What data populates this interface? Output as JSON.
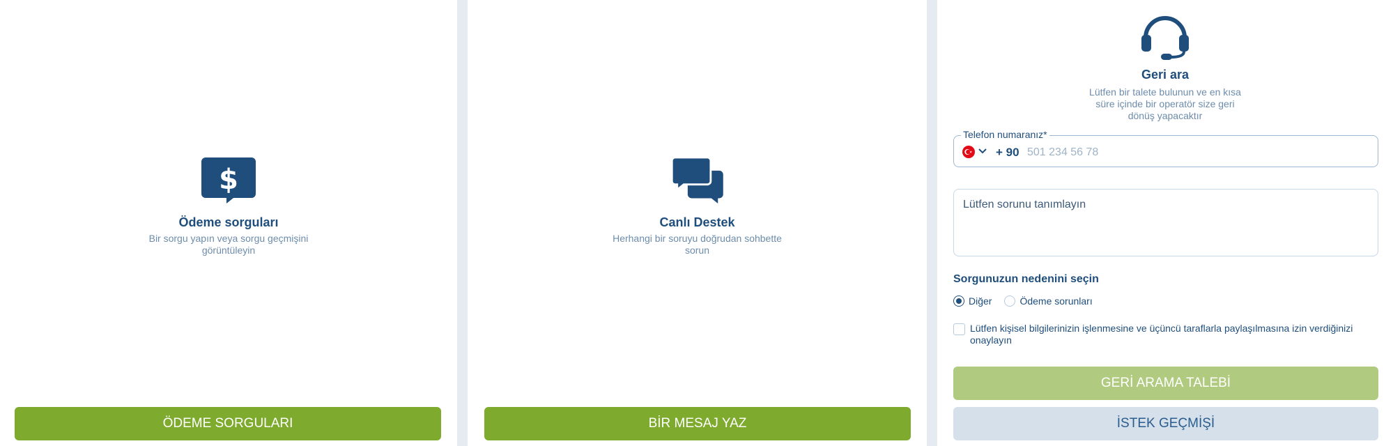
{
  "payment": {
    "icon": "dollar-speech-bubble-icon",
    "title": "Ödeme sorguları",
    "description": "Bir sorgu yapın veya sorgu geçmişini görüntüleyin",
    "button": "ÖDEME SORGULARI"
  },
  "live_support": {
    "icon": "chat-bubbles-icon",
    "title": "Canlı Destek",
    "description": "Herhangi bir soruyu doğrudan sohbette sorun",
    "button": "BİR MESAJ YAZ"
  },
  "callback": {
    "icon": "headset-icon",
    "title": "Geri ara",
    "description": "Lütfen bir talete bulunun ve en kısa süre içinde bir operatör size geri dönüş yapacaktır",
    "phone": {
      "label": "Telefon numaranız*",
      "flag_icon": "turkey-flag-icon",
      "dial_code": "+ 90",
      "placeholder": "501 234 56 78",
      "value": ""
    },
    "problem_placeholder": "Lütfen sorunu tanımlayın",
    "reason_label": "Sorgunuzun nedenini seçin",
    "reasons": [
      {
        "label": "Diğer",
        "checked": true
      },
      {
        "label": "Ödeme sorunları",
        "checked": false
      }
    ],
    "consent": "Lütfen kişisel bilgilerinizin işlenmesine ve üçüncü taraflarla paylaşılmasına izin verdiğinizi onaylayın",
    "consent_checked": false,
    "request_button": "GERİ ARAMA TALEBİ",
    "history_button": "İSTEK GEÇMİŞİ"
  },
  "colors": {
    "primary_dark": "#1f4e7c",
    "muted_text": "#6d8cab",
    "green": "#7eab2e",
    "green_disabled": "#b0cb7f",
    "secondary_button": "#d5e0ea",
    "background": "#e6ebf1"
  }
}
